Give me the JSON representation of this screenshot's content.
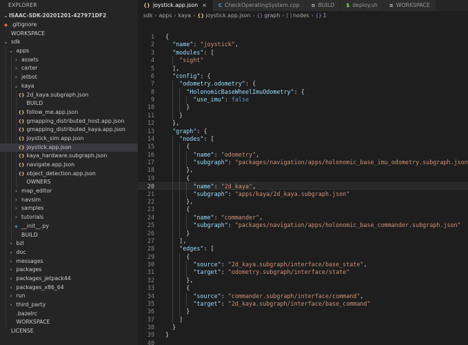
{
  "sidebar": {
    "header": "EXPLORER",
    "root": "ISAAC-SDK-20201201-427971DF2",
    "items": [
      {
        "label": ".gitignore",
        "depth": 1,
        "kind": "git"
      },
      {
        "label": "WORKSPACE",
        "depth": 1,
        "kind": "blank"
      },
      {
        "label": "sdk",
        "depth": 1,
        "kind": "folder-open"
      },
      {
        "label": "apps",
        "depth": 2,
        "kind": "folder-open"
      },
      {
        "label": "assets",
        "depth": 3,
        "kind": "folder"
      },
      {
        "label": "carter",
        "depth": 3,
        "kind": "folder"
      },
      {
        "label": "jetbot",
        "depth": 3,
        "kind": "folder"
      },
      {
        "label": "kaya",
        "depth": 3,
        "kind": "folder-open"
      },
      {
        "label": "2d_kaya.subgraph.json",
        "depth": 4,
        "kind": "json"
      },
      {
        "label": "BUILD",
        "depth": 4,
        "kind": "blank"
      },
      {
        "label": "follow_me.app.json",
        "depth": 4,
        "kind": "json"
      },
      {
        "label": "gmapping_distributed_host.app.json",
        "depth": 4,
        "kind": "json"
      },
      {
        "label": "gmapping_distributed_kaya.app.json",
        "depth": 4,
        "kind": "json"
      },
      {
        "label": "joystick_sim.app.json",
        "depth": 4,
        "kind": "json"
      },
      {
        "label": "joystick.app.json",
        "depth": 4,
        "kind": "json",
        "selected": true
      },
      {
        "label": "kaya_hardware.subgraph.json",
        "depth": 4,
        "kind": "json"
      },
      {
        "label": "navigate.app.json",
        "depth": 4,
        "kind": "json"
      },
      {
        "label": "object_detection.app.json",
        "depth": 4,
        "kind": "json"
      },
      {
        "label": "OWNERS",
        "depth": 4,
        "kind": "blank"
      },
      {
        "label": "map_editor",
        "depth": 3,
        "kind": "folder"
      },
      {
        "label": "navsim",
        "depth": 3,
        "kind": "folder"
      },
      {
        "label": "samples",
        "depth": 3,
        "kind": "folder"
      },
      {
        "label": "tutorials",
        "depth": 3,
        "kind": "folder"
      },
      {
        "label": "__init__.py",
        "depth": 3,
        "kind": "py"
      },
      {
        "label": "BUILD",
        "depth": 3,
        "kind": "blank"
      },
      {
        "label": "bzl",
        "depth": 2,
        "kind": "folder"
      },
      {
        "label": "doc",
        "depth": 2,
        "kind": "folder"
      },
      {
        "label": "messages",
        "depth": 2,
        "kind": "folder"
      },
      {
        "label": "packages",
        "depth": 2,
        "kind": "folder"
      },
      {
        "label": "packages_jetpack44",
        "depth": 2,
        "kind": "folder"
      },
      {
        "label": "packages_x86_64",
        "depth": 2,
        "kind": "folder"
      },
      {
        "label": "run",
        "depth": 2,
        "kind": "folder"
      },
      {
        "label": "third_party",
        "depth": 2,
        "kind": "folder"
      },
      {
        "label": ".bazelrc",
        "depth": 2,
        "kind": "blank"
      },
      {
        "label": "WORKSPACE",
        "depth": 2,
        "kind": "blank"
      },
      {
        "label": "LICENSE",
        "depth": 1,
        "kind": "blank"
      }
    ]
  },
  "tabs": [
    {
      "label": "joystick.app.json",
      "icon": "json",
      "active": true,
      "closable": true
    },
    {
      "label": "CheckOperatingSystem.cpp",
      "icon": "cpp",
      "active": false
    },
    {
      "label": "BUILD",
      "icon": "build",
      "active": false,
      "italic": true
    },
    {
      "label": "deploy.sh",
      "icon": "sh",
      "active": false
    },
    {
      "label": "WORKSPACE",
      "icon": "build",
      "active": false
    }
  ],
  "breadcrumb": {
    "parts": [
      "sdk",
      "apps",
      "kaya"
    ],
    "file": "joystick.app.json",
    "symbols": [
      "graph",
      "nodes",
      "1"
    ]
  },
  "editor": {
    "current_line": 20,
    "lines": [
      [
        [
          "p",
          "{"
        ]
      ],
      [
        [
          "p",
          "  "
        ],
        [
          "k",
          "\"name\""
        ],
        [
          "p",
          ": "
        ],
        [
          "s",
          "\"joystick\""
        ],
        [
          "p",
          ","
        ]
      ],
      [
        [
          "p",
          "  "
        ],
        [
          "k",
          "\"modules\""
        ],
        [
          "p",
          ": ["
        ]
      ],
      [
        [
          "p",
          "    "
        ],
        [
          "s",
          "\"sight\""
        ]
      ],
      [
        [
          "p",
          "  ],"
        ]
      ],
      [
        [
          "p",
          "  "
        ],
        [
          "k",
          "\"config\""
        ],
        [
          "p",
          ": {"
        ]
      ],
      [
        [
          "p",
          "    "
        ],
        [
          "k",
          "\"odometry.odometry\""
        ],
        [
          "p",
          ": {"
        ]
      ],
      [
        [
          "p",
          "      "
        ],
        [
          "k",
          "\"HolonomicBaseWheelImuOdometry\""
        ],
        [
          "p",
          ": {"
        ]
      ],
      [
        [
          "p",
          "        "
        ],
        [
          "k",
          "\"use_imu\""
        ],
        [
          "p",
          ": "
        ],
        [
          "b",
          "false"
        ]
      ],
      [
        [
          "p",
          "      }"
        ]
      ],
      [
        [
          "p",
          "    }"
        ]
      ],
      [
        [
          "p",
          "  },"
        ]
      ],
      [
        [
          "p",
          "  "
        ],
        [
          "k",
          "\"graph\""
        ],
        [
          "p",
          ": {"
        ]
      ],
      [
        [
          "p",
          "    "
        ],
        [
          "k",
          "\"nodes\""
        ],
        [
          "p",
          ": ["
        ]
      ],
      [
        [
          "p",
          "      {"
        ]
      ],
      [
        [
          "p",
          "        "
        ],
        [
          "k",
          "\"name\""
        ],
        [
          "p",
          ": "
        ],
        [
          "s",
          "\"odometry\""
        ],
        [
          "p",
          ","
        ]
      ],
      [
        [
          "p",
          "        "
        ],
        [
          "k",
          "\"subgraph\""
        ],
        [
          "p",
          ": "
        ],
        [
          "s",
          "\"packages/navigation/apps/holonomic_base_imu_odometry.subgraph.json\""
        ]
      ],
      [
        [
          "p",
          "      },"
        ]
      ],
      [
        [
          "p",
          "      {"
        ]
      ],
      [
        [
          "p",
          "        "
        ],
        [
          "k",
          "\"name\""
        ],
        [
          "p",
          ": "
        ],
        [
          "s",
          "\"2d_kaya\""
        ],
        [
          "p",
          ","
        ]
      ],
      [
        [
          "p",
          "        "
        ],
        [
          "k",
          "\"subgraph\""
        ],
        [
          "p",
          ": "
        ],
        [
          "s",
          "\"apps/kaya/2d_kaya.subgraph.json\""
        ]
      ],
      [
        [
          "p",
          "      },"
        ]
      ],
      [
        [
          "p",
          "      {"
        ]
      ],
      [
        [
          "p",
          "        "
        ],
        [
          "k",
          "\"name\""
        ],
        [
          "p",
          ": "
        ],
        [
          "s",
          "\"commander\""
        ],
        [
          "p",
          ","
        ]
      ],
      [
        [
          "p",
          "        "
        ],
        [
          "k",
          "\"subgraph\""
        ],
        [
          "p",
          ": "
        ],
        [
          "s",
          "\"packages/navigation/apps/holonomic_base_commander.subgraph.json\""
        ]
      ],
      [
        [
          "p",
          "      }"
        ]
      ],
      [
        [
          "p",
          "    ],"
        ]
      ],
      [
        [
          "p",
          "    "
        ],
        [
          "k",
          "\"edges\""
        ],
        [
          "p",
          ": ["
        ]
      ],
      [
        [
          "p",
          "      {"
        ]
      ],
      [
        [
          "p",
          "        "
        ],
        [
          "k",
          "\"source\""
        ],
        [
          "p",
          ": "
        ],
        [
          "s",
          "\"2d_kaya.subgraph/interface/base_state\""
        ],
        [
          "p",
          ","
        ]
      ],
      [
        [
          "p",
          "        "
        ],
        [
          "k",
          "\"target\""
        ],
        [
          "p",
          ": "
        ],
        [
          "s",
          "\"odometry.subgraph/interface/state\""
        ]
      ],
      [
        [
          "p",
          "      },"
        ]
      ],
      [
        [
          "p",
          "      {"
        ]
      ],
      [
        [
          "p",
          "        "
        ],
        [
          "k",
          "\"source\""
        ],
        [
          "p",
          ": "
        ],
        [
          "s",
          "\"commander.subgraph/interface/command\""
        ],
        [
          "p",
          ","
        ]
      ],
      [
        [
          "p",
          "        "
        ],
        [
          "k",
          "\"target\""
        ],
        [
          "p",
          ": "
        ],
        [
          "s",
          "\"2d_kaya.subgraph/interface/base_command\""
        ]
      ],
      [
        [
          "p",
          "      }"
        ]
      ],
      [
        [
          "p",
          "    ]"
        ]
      ],
      [
        [
          "p",
          "  }"
        ]
      ],
      [
        [
          "p",
          "}"
        ]
      ],
      []
    ]
  }
}
